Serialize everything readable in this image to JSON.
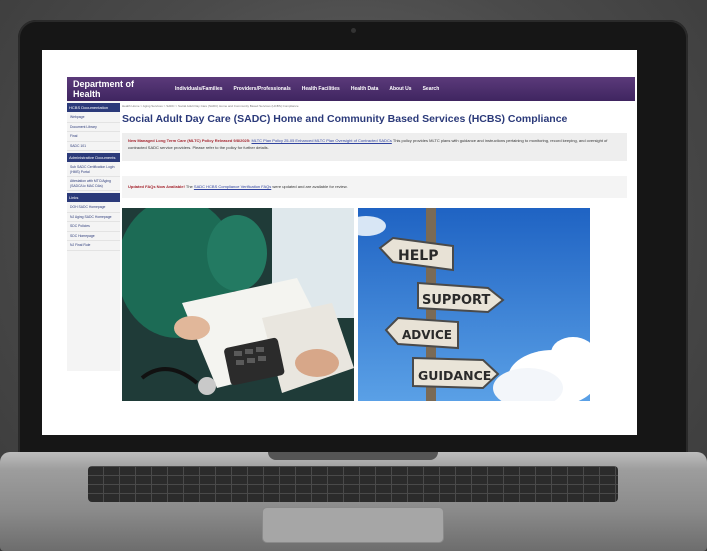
{
  "site": {
    "brand": "Department of Health",
    "nav": [
      "Individuals/Families",
      "Providers/Professionals",
      "Health Facilities",
      "Health Data",
      "About Us"
    ],
    "search_label": "Search"
  },
  "sidebar": {
    "head1": "HCBS Documentation",
    "items1": [
      "Webpage",
      "Document Library",
      "Final",
      "SADC 101"
    ],
    "head2": "Administrative Documents",
    "items2": [
      "Sub SADC Certification Login (HMS) Portal",
      "Attestation with MTC/Aging (SADC/Lic MAC DAs)"
    ],
    "head3": "Links",
    "items3": [
      "DOH SADC Homepage",
      "NJ Aging SADC Homepage",
      "SDC Policies",
      "SDC Homepage",
      "NJ Final Rule"
    ]
  },
  "main": {
    "breadcrumb": "Health Home > Aging Services > SADC > Social Adult Day Care (SADC) Home and Community Based Services (HCBS) Compliance",
    "title": "Social Adult Day Care (SADC) Home and Community Based Services (HCBS) Compliance",
    "notice1": {
      "lead": "New Managed Long Term Care (MLTC) Policy Released 9/8/2025:",
      "link": "MLTC Plan Policy 25-05 Enhanced MLTC Plan Oversight of Contracted SADCs",
      "body": "This policy provides MLTC plans with guidance and instructions pertaining to monitoring, record keeping, and oversight of contracted SADC service providers. Please refer to the policy for further details."
    },
    "notice2": {
      "lead": "Updated FAQs Now Available!",
      "pre": "The",
      "link": "SADC HCBS Compliance Verification FAQs",
      "body": "were updated and are available for review."
    },
    "signs": [
      "HELP",
      "SUPPORT",
      "ADVICE",
      "GUIDANCE"
    ]
  },
  "colors": {
    "nav": "#4b2e6e",
    "title": "#2b3a7a",
    "alert": "#a4232d",
    "link": "#3144a0"
  }
}
